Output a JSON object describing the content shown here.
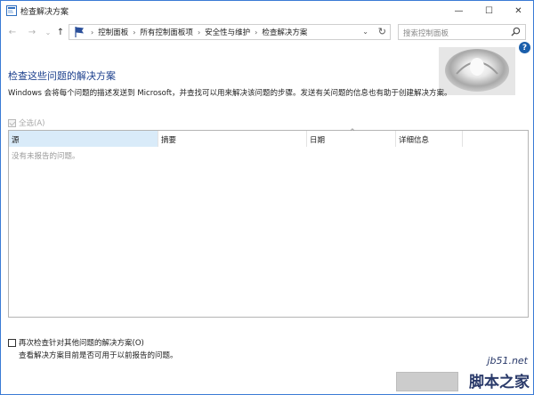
{
  "window": {
    "title": "检查解决方案",
    "controls": {
      "minimize": "—",
      "maximize": "☐",
      "close": "✕"
    }
  },
  "nav": {
    "breadcrumbs": [
      "控制面板",
      "所有控制面板项",
      "安全性与维护",
      "检查解决方案"
    ],
    "search_placeholder": "搜索控制面板"
  },
  "main": {
    "title": "检查这些问题的解决方案",
    "description": "Windows 会将每个问题的描述发送到 Microsoft，并查找可以用来解决该问题的步骤。发送有关问题的信息也有助于创建解决方案。",
    "select_all_label": "全选(A)",
    "columns": [
      "源",
      "摘要",
      "日期",
      "详细信息"
    ],
    "empty_message": "没有未报告的问题。",
    "recheck_label": "再次检查针对其他问题的解决方案(O)",
    "recheck_sub": "查看解决方案目前是否可用于以前报告的问题。"
  },
  "watermark": {
    "url": "jb51.net",
    "text": "脚本之家"
  },
  "colors": {
    "title_blue": "#1a3e8c",
    "selected_header": "#d9ebf9",
    "window_border": "#3a7bd5"
  }
}
